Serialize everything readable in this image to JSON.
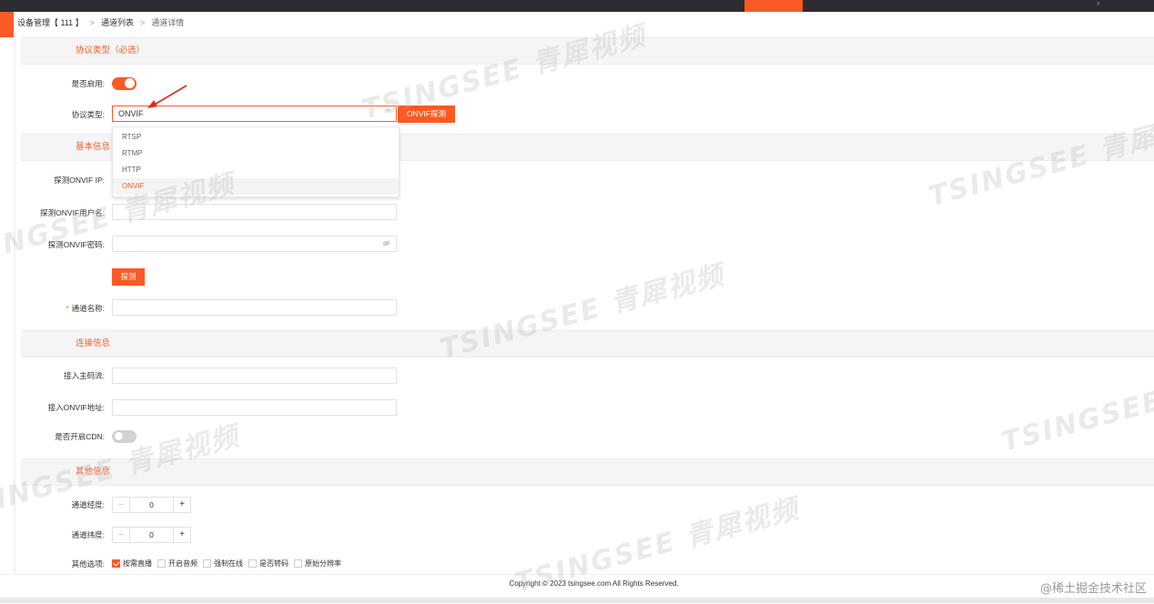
{
  "breadcrumb": {
    "device": "设备管理【 111 】",
    "list": "通道列表",
    "detail": "通道详情",
    "separator": ">"
  },
  "sections": {
    "protocol": "协议类型（必选）",
    "basic": "基本信息",
    "connection": "连接信息",
    "other": "其他信息"
  },
  "protocol": {
    "enabled_label": "是否启用:",
    "enabled": true,
    "type_label": "协议类型:",
    "type_value": "ONVIF",
    "probe_button": "ONVIF探测",
    "options": [
      "RTSP",
      "RTMP",
      "HTTP",
      "ONVIF"
    ],
    "selected_option": "ONVIF"
  },
  "basic": {
    "ip_label": "探测ONVIF IP:",
    "user_label": "探测ONVIF用户名:",
    "password_label": "探测ONVIF密码:",
    "probe_button": "探测",
    "channel_name_label": "通道名称:",
    "required_mark": "*"
  },
  "connection": {
    "main_stream_label": "接入主码流:",
    "onvif_address_label": "接入ONVIF地址:",
    "cdn_label": "是否开启CDN:",
    "cdn_enabled": false
  },
  "other": {
    "longitude_label": "通道经度:",
    "longitude_value": "0",
    "latitude_label": "通道纬度:",
    "latitude_value": "0",
    "minus": "–",
    "plus": "+",
    "options_label": "其他选项:",
    "checkboxes": [
      {
        "label": "按需直播",
        "checked": true
      },
      {
        "label": "开启音频",
        "checked": false
      },
      {
        "label": "强制在线",
        "checked": false
      },
      {
        "label": "是否转码",
        "checked": false
      },
      {
        "label": "原始分辨率",
        "checked": false
      }
    ]
  },
  "footer": {
    "copyright": "Copyright © 2023 tsingsee.com All Rights Reserved.",
    "credit": "@稀土掘金技术社区"
  },
  "watermark": "TSINGSEE 青犀视频",
  "topbar_corner": "ʸ",
  "colors": {
    "accent": "#fa5a24",
    "topbar": "#2b2d31",
    "section_bg": "#f5f5f5"
  },
  "icons": {
    "select": "chevron-up-icon",
    "password": "eye-off-icon",
    "annotation": "red-arrow-icon"
  }
}
